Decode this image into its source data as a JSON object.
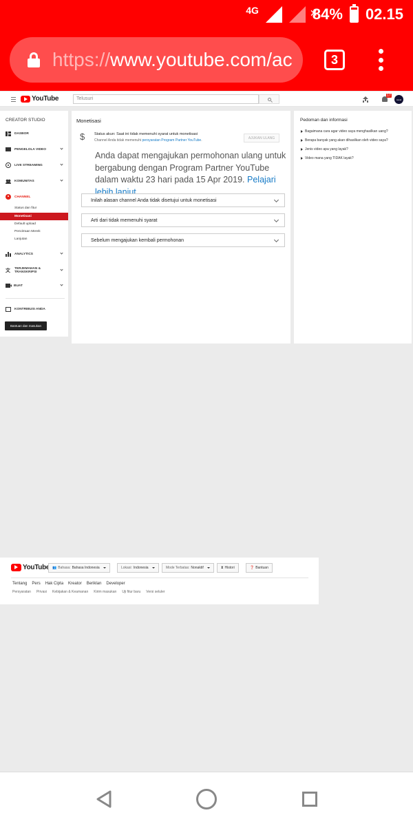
{
  "status_bar": {
    "network": "4G",
    "battery_percent": "84%",
    "battery_level": 0.84,
    "time": "02.15"
  },
  "browser": {
    "url_dim": "https://",
    "url_main": "www.youtube.com/ac",
    "tab_count": "3"
  },
  "header": {
    "logo_text": "YouTube",
    "search_placeholder": "Telusuri",
    "notification_count": "17",
    "avatar_text": "canal"
  },
  "sidebar": {
    "title": "CREATOR STUDIO",
    "items": [
      {
        "label": "DASBOR"
      },
      {
        "label": "PENGELOLA VIDEO"
      },
      {
        "label": "LIVE STREAMING"
      },
      {
        "label": "KOMUNITAS"
      },
      {
        "label": "CHANNEL"
      },
      {
        "label": "ANALYTICS"
      },
      {
        "label": "TERJEMAHAN & TRANSKRIPSI"
      },
      {
        "label": "BUAT"
      },
      {
        "label": "KONTRIBUSI ANDA"
      }
    ],
    "channel_sub": [
      "Status dan fitur",
      "Monetisasi",
      "Default upload",
      "Pencitraan Merek",
      "Lanjutan"
    ],
    "help_button": "Bantuan dan masukan"
  },
  "main": {
    "title": "Monetisasi",
    "status_line": "Status akun: Saat ini tidak memenuhi syarat untuk monetisasi",
    "status_sub_prefix": "Channel Anda tidak memenuhi ",
    "status_sub_link": "persyaratan Program Partner YouTube",
    "status_sub_suffix": ".",
    "reapply_button": "AJUKAN ULANG",
    "message": "Anda dapat mengajukan permohonan ulang untuk bergabung dengan Program Partner YouTube dalam waktu 23 hari pada 15 Apr 2019.",
    "message_link": "Pelajari lebih lanjut",
    "accordions": [
      "Inilah alasan channel Anda tidak disetujui untuk monetisasi",
      "Arti dari tidak memenuhi syarat",
      "Sebelum mengajukan kembali permohonan"
    ]
  },
  "right_panel": {
    "title": "Pedoman dan informasi",
    "items": [
      "Bagaimana cara agar video saya menghasilkan uang?",
      "Berapa banyak yang akan dihasilkan oleh video saya?",
      "Jenis video apa yang layak?",
      "Video mana yang TIDAK layak?"
    ]
  },
  "footer": {
    "logo_text": "YouTube",
    "language_label": "Bahasa:",
    "language_value": "Bahasa Indonesia",
    "location_label": "Lokasi:",
    "location_value": "Indonesia",
    "restricted_label": "Mode Terbatas:",
    "restricted_value": "Nonaktif",
    "history": "Histori",
    "help": "Bantuan",
    "links": [
      "Tentang",
      "Pers",
      "Hak Cipta",
      "Kreator",
      "Beriklan",
      "Developer"
    ],
    "links2": [
      "Persyaratan",
      "Privasi",
      "Kebijakan & Keamanan",
      "Kirim masukan",
      "Uji fitur baru",
      "Versi seluler"
    ]
  }
}
